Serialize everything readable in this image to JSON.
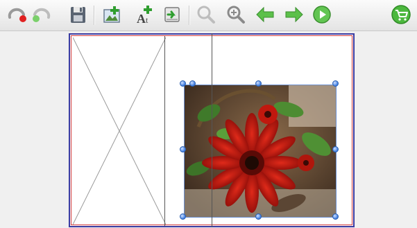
{
  "toolbar": {
    "items": [
      {
        "name": "undo",
        "icon": "undo-arrow-icon"
      },
      {
        "name": "redo",
        "icon": "redo-arrow-icon"
      },
      {
        "name": "save",
        "icon": "floppy-disk-icon"
      },
      {
        "name": "add-image",
        "icon": "add-image-icon"
      },
      {
        "name": "add-text",
        "icon": "add-text-icon"
      },
      {
        "name": "insert-page",
        "icon": "insert-page-icon"
      },
      {
        "name": "zoom-out",
        "icon": "zoom-out-icon"
      },
      {
        "name": "zoom-in",
        "icon": "zoom-in-icon"
      },
      {
        "name": "previous-page",
        "icon": "arrow-left-icon"
      },
      {
        "name": "next-page",
        "icon": "arrow-right-icon"
      },
      {
        "name": "play-preview",
        "icon": "play-icon"
      },
      {
        "name": "cart",
        "icon": "shopping-cart-icon"
      }
    ]
  },
  "canvas": {
    "left_page": {
      "content": "empty-image-placeholder"
    },
    "right_page": {
      "content": "photo-red-gerbera-flower",
      "selected": true
    }
  },
  "colors": {
    "spread_border": "#3a3aa0",
    "page_border": "#d23a3a",
    "selection_handle": "#3b7be0",
    "toolbar_green": "#3aa33a"
  }
}
